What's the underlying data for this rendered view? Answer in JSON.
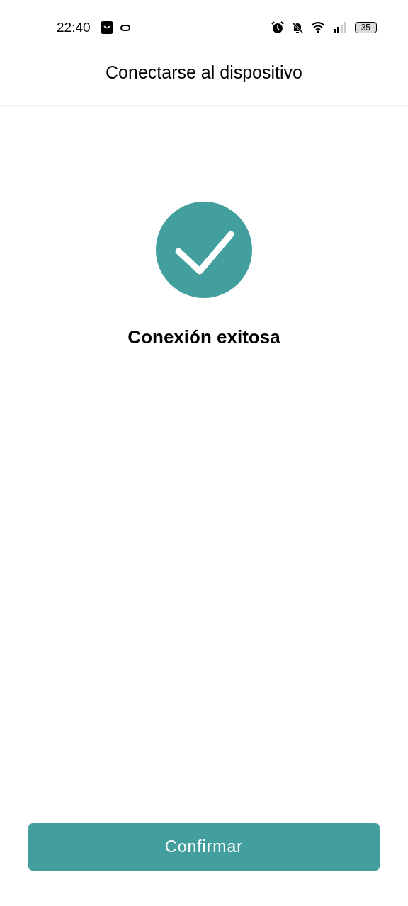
{
  "status_bar": {
    "time": "22:40",
    "battery": "35"
  },
  "header": {
    "title": "Conectarse al dispositivo"
  },
  "result": {
    "message": "Conexión exitosa"
  },
  "buttons": [
    {
      "label": "Confirmar"
    }
  ]
}
